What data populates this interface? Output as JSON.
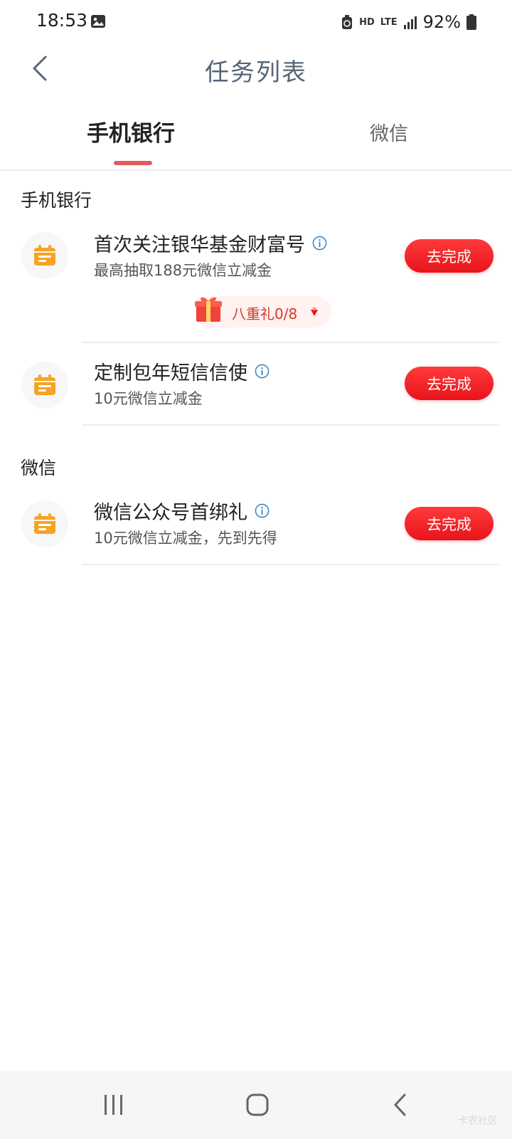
{
  "status_bar": {
    "time": "18:53",
    "hd_label": "HD",
    "lte_label": "LTE",
    "battery": "92%"
  },
  "header": {
    "title": "任务列表"
  },
  "tabs": [
    {
      "label": "手机银行",
      "active": true
    },
    {
      "label": "微信",
      "active": false
    }
  ],
  "sections": {
    "bank": {
      "title": "手机银行",
      "tasks": [
        {
          "title": "首次关注银华基金财富号",
          "subtitle": "最高抽取188元微信立减金",
          "button": "去完成",
          "gift": {
            "label": "八重礼0/8"
          }
        },
        {
          "title": "定制包年短信信使",
          "subtitle": "10元微信立减金",
          "button": "去完成"
        }
      ]
    },
    "wechat": {
      "title": "微信",
      "tasks": [
        {
          "title": "微信公众号首绑礼",
          "subtitle": "10元微信立减金，先到先得",
          "button": "去完成"
        }
      ]
    }
  },
  "nav_bar": {
    "watermark": "卡农社区"
  },
  "colors": {
    "accent_red": "#e8141c",
    "tab_indicator": "#e55a5a",
    "icon_orange": "#f5a425",
    "title_gray": "#556677"
  }
}
